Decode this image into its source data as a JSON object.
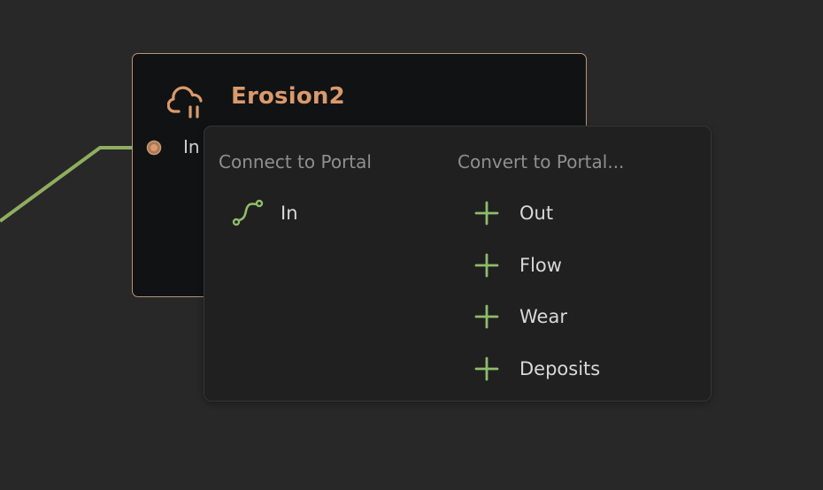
{
  "colors": {
    "canvas_bg": "#282828",
    "node_bg": "#111213",
    "node_border": "#b69478",
    "accent_orange": "#d99a6c",
    "wire_green": "#8fae5f",
    "icon_green": "#8fbc6a",
    "popup_bg": "#202020",
    "muted_text": "#8f8f8f"
  },
  "node": {
    "title": "Erosion2",
    "icon": "cloud-rain-icon",
    "input_port": {
      "label": "In"
    }
  },
  "context_menu": {
    "connect": {
      "header": "Connect to Portal",
      "items": [
        {
          "label": "In",
          "icon": "portal-route-icon"
        }
      ]
    },
    "convert": {
      "header": "Convert to Portal...",
      "items": [
        {
          "label": "Out",
          "icon": "plus-icon"
        },
        {
          "label": "Flow",
          "icon": "plus-icon"
        },
        {
          "label": "Wear",
          "icon": "plus-icon"
        },
        {
          "label": "Deposits",
          "icon": "plus-icon"
        }
      ]
    }
  }
}
